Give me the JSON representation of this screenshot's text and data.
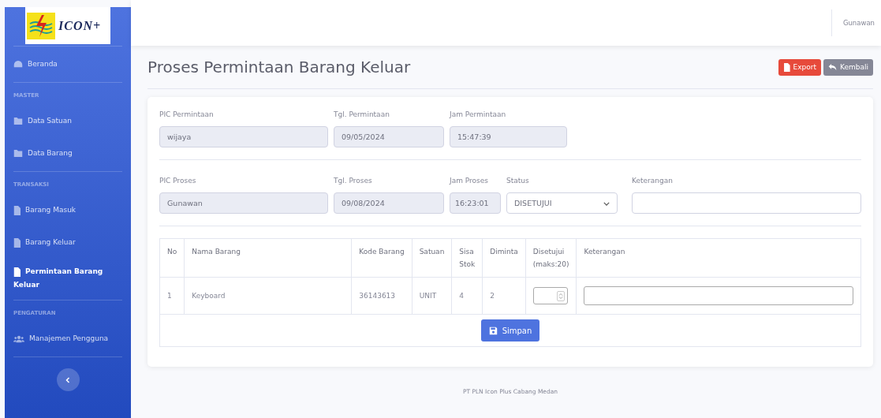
{
  "logo": {
    "text": "ICON+"
  },
  "sidebar": {
    "items": [
      {
        "kind": "link",
        "label": "Beranda",
        "selected": false
      },
      {
        "kind": "heading",
        "label": "MASTER"
      },
      {
        "kind": "link",
        "label": "Data Satuan",
        "selected": false
      },
      {
        "kind": "link",
        "label": "Data Barang",
        "selected": false
      },
      {
        "kind": "heading",
        "label": "TRANSAKSI"
      },
      {
        "kind": "link",
        "label": "Barang Masuk",
        "selected": false
      },
      {
        "kind": "link",
        "label": "Barang Keluar",
        "selected": false
      },
      {
        "kind": "link",
        "label": "Permintaan Barang Keluar",
        "selected": true
      },
      {
        "kind": "heading",
        "label": "PENGATURAN"
      },
      {
        "kind": "link",
        "label": "Manajemen Pengguna",
        "selected": false
      }
    ]
  },
  "topbar": {
    "user": "Gunawan"
  },
  "page": {
    "title": "Proses Permintaan Barang Keluar",
    "buttons": [
      {
        "kind": "danger",
        "label": "Export"
      },
      {
        "kind": "secondary",
        "label": "Kembali"
      }
    ]
  },
  "form": {
    "rows": [
      [
        {
          "label": "PIC Permintaan",
          "value": "wijaya",
          "readonly": true
        },
        {
          "label": "Tgl. Permintaan",
          "value": "09/05/2024",
          "readonly": true
        },
        {
          "label": "Jam Permintaan",
          "value": "15:47:39",
          "readonly": true
        }
      ],
      [
        {
          "label": "PIC Proses",
          "value": "Gunawan",
          "readonly": true
        },
        {
          "label": "Tgl. Proses",
          "value": "09/08/2024",
          "readonly": true
        },
        {
          "label": "Jam Proses",
          "value": "16:23:01",
          "readonly": true
        },
        {
          "label": "Status",
          "value": "DISETUJUI",
          "kind": "select",
          "readonly": false
        },
        {
          "label": "Keterangan",
          "readonly": false
        }
      ]
    ]
  },
  "table": {
    "columns": [
      "No",
      "Nama Barang",
      "Kode Barang",
      "Satuan",
      "Sisa Stok",
      "Diminta",
      "Disetujui (maks:20)",
      "Keterangan"
    ],
    "rows": [
      [
        "1",
        "Keyboard",
        "36143613",
        "UNIT",
        "4",
        "2"
      ]
    ]
  },
  "save_button": {
    "label": "Simpan"
  },
  "footer": "PT PLN Icon Plus Cabang Medan"
}
